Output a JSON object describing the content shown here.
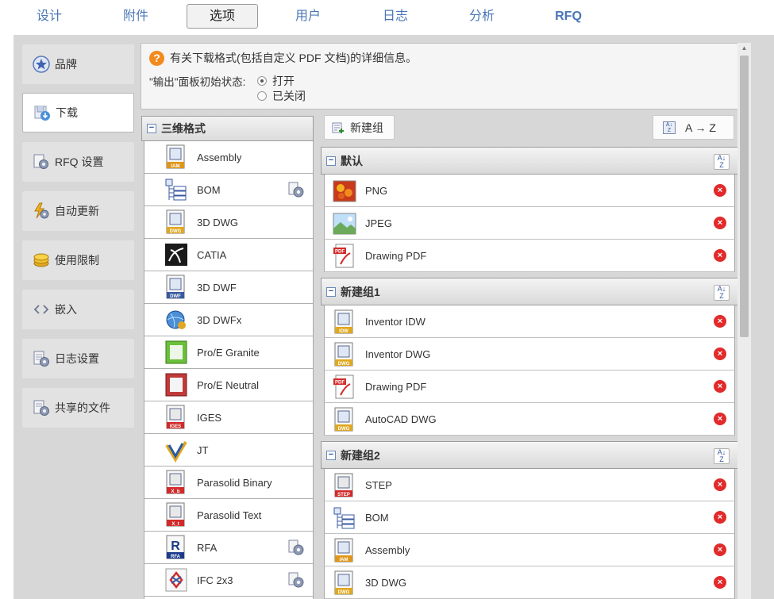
{
  "tabs": [
    {
      "label": "设计"
    },
    {
      "label": "附件"
    },
    {
      "label": "选项"
    },
    {
      "label": "用户"
    },
    {
      "label": "日志"
    },
    {
      "label": "分析"
    },
    {
      "label": "RFQ"
    }
  ],
  "active_tab": "选项",
  "sidebar": {
    "items": [
      {
        "label": "品牌",
        "icon": "star-badge-icon"
      },
      {
        "label": "下载",
        "icon": "download-icon"
      },
      {
        "label": "RFQ 设置",
        "icon": "settings-doc-icon"
      },
      {
        "label": "自动更新",
        "icon": "auto-update-icon"
      },
      {
        "label": "使用限制",
        "icon": "coins-icon"
      },
      {
        "label": "嵌入",
        "icon": "embed-code-icon"
      },
      {
        "label": "日志设置",
        "icon": "log-settings-icon"
      },
      {
        "label": "共享的文件",
        "icon": "shared-files-icon"
      }
    ],
    "active": "下载"
  },
  "info": {
    "help_icon": "?",
    "text": "有关下载格式(包括自定义 PDF 文档)的详细信息。",
    "state_label": "\"输出\"面板初始状态:",
    "options": [
      "打开",
      "已关闭"
    ],
    "selected": "打开"
  },
  "formats": {
    "header": "三维格式",
    "items": [
      {
        "label": "Assembly",
        "icon": "iam-file-icon",
        "gear": false
      },
      {
        "label": "BOM",
        "icon": "bom-icon",
        "gear": true
      },
      {
        "label": "3D DWG",
        "icon": "dwg-file-icon",
        "gear": false
      },
      {
        "label": "CATIA",
        "icon": "catia-logo-icon",
        "gear": false
      },
      {
        "label": "3D DWF",
        "icon": "dwf-file-icon",
        "gear": false
      },
      {
        "label": "3D DWFx",
        "icon": "dwfx-globe-icon",
        "gear": false
      },
      {
        "label": "Pro/E Granite",
        "icon": "proe-granite-icon",
        "gear": false
      },
      {
        "label": "Pro/E Neutral",
        "icon": "proe-neutral-icon",
        "gear": false
      },
      {
        "label": "IGES",
        "icon": "iges-file-icon",
        "gear": false
      },
      {
        "label": "JT",
        "icon": "jt-logo-icon",
        "gear": false
      },
      {
        "label": "Parasolid Binary",
        "icon": "parasolid-binary-icon",
        "gear": false
      },
      {
        "label": "Parasolid Text",
        "icon": "parasolid-text-icon",
        "gear": false
      },
      {
        "label": "RFA",
        "icon": "rfa-file-icon",
        "gear": true
      },
      {
        "label": "IFC 2x3",
        "icon": "ifc-logo-icon",
        "gear": true
      }
    ]
  },
  "buttons": {
    "new_group": "新建组",
    "sort": "A → Z"
  },
  "groups": [
    {
      "name": "默认",
      "items": [
        {
          "label": "PNG",
          "icon": "png-image-icon"
        },
        {
          "label": "JPEG",
          "icon": "jpeg-image-icon"
        },
        {
          "label": "Drawing PDF",
          "icon": "pdf-file-icon"
        }
      ]
    },
    {
      "name": "新建组1",
      "items": [
        {
          "label": "Inventor IDW",
          "icon": "idw-file-icon"
        },
        {
          "label": "Inventor DWG",
          "icon": "dwg-file-icon"
        },
        {
          "label": "Drawing PDF",
          "icon": "pdf-file-icon"
        },
        {
          "label": "AutoCAD DWG",
          "icon": "dwg-file-icon"
        }
      ]
    },
    {
      "name": "新建组2",
      "items": [
        {
          "label": "STEP",
          "icon": "step-file-icon"
        },
        {
          "label": "BOM",
          "icon": "bom-icon"
        },
        {
          "label": "Assembly",
          "icon": "iam-file-icon"
        },
        {
          "label": "3D DWG",
          "icon": "dwg-file-icon"
        }
      ]
    }
  ],
  "colors": {
    "tab_text": "#4a76b8",
    "delete": "#e22a2a",
    "help": "#f28a1e"
  }
}
